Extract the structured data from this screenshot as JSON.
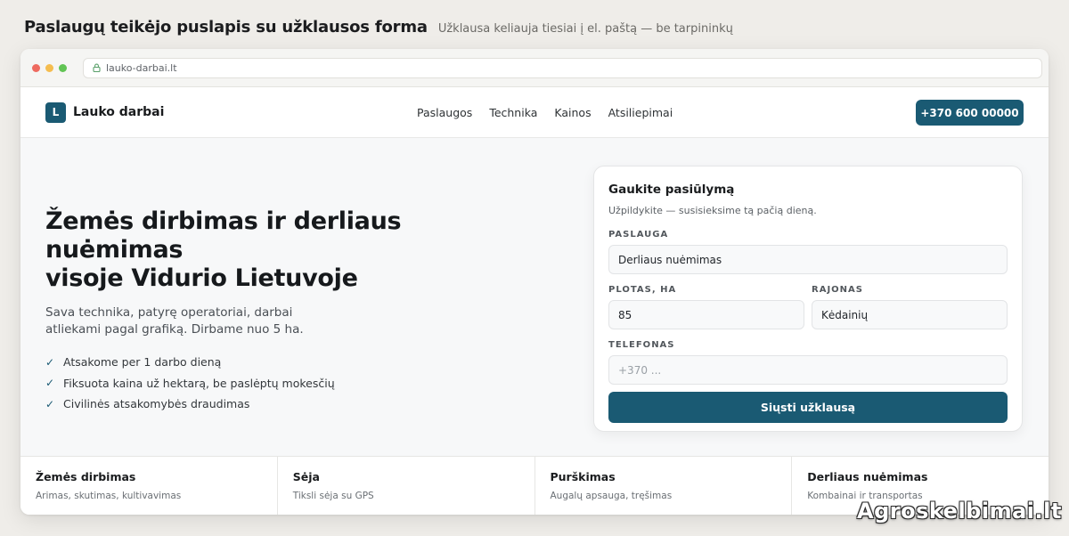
{
  "page": {
    "title": "Paslaugų teikėjo puslapis su užklausos forma",
    "subtitle": "Užklausa keliauja tiesiai į el. paštą — be tarpininkų"
  },
  "browser": {
    "url": "lauko-darbai.lt",
    "icons": [
      "close-dot",
      "minimize-dot",
      "maximize-dot",
      "lock-icon"
    ]
  },
  "site": {
    "logo_letter": "L",
    "brand": "Lauko darbai",
    "nav": [
      "Paslaugos",
      "Technika",
      "Kainos",
      "Atsiliepimai"
    ],
    "phone": "+370 600 00000"
  },
  "hero": {
    "title_line1": "Žemės dirbimas ir derliaus nuėmimas",
    "title_line2": "visoje Vidurio Lietuvoje",
    "description": "Sava technika, patyrę operatoriai, darbai atliekami pagal grafiką. Dirbame nuo 5 ha.",
    "features": [
      "Atsakome per 1 darbo dieną",
      "Fiksuota kaina už hektarą, be paslėptų mokesčių",
      "Civilinės atsakomybės draudimas"
    ],
    "check_symbol": "✓"
  },
  "form": {
    "title": "Gaukite pasiūlymą",
    "subtitle": "Užpildykite — susisieksime tą pačią dieną.",
    "service_label": "PASLAUGA",
    "service_value": "Derliaus nuėmimas",
    "area_label": "PLOTAS, HA",
    "area_value": "85",
    "district_label": "RAJONAS",
    "district_value": "Kėdainių",
    "phone_label": "TELEFONAS",
    "phone_placeholder": "+370 ...",
    "submit": "Siųsti užklausą"
  },
  "services": [
    {
      "title": "Žemės dirbimas",
      "desc": "Arimas, skutimas, kultivavimas"
    },
    {
      "title": "Sėja",
      "desc": "Tiksli sėja su GPS"
    },
    {
      "title": "Purškimas",
      "desc": "Augalų apsauga, tręšimas"
    },
    {
      "title": "Derliaus nuėmimas",
      "desc": "Kombainai ir transportas"
    }
  ],
  "watermark": "Agroskelbimai.lt",
  "colors": {
    "accent": "#1a5a73",
    "page_bg": "#efede9",
    "hero_bg": "#f7f8f9"
  }
}
